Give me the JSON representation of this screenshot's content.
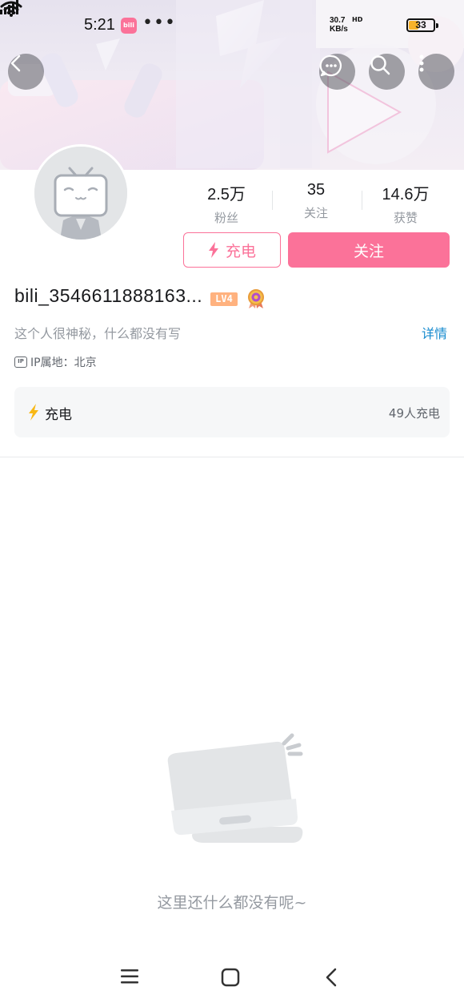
{
  "status_bar": {
    "time": "5:21",
    "app_badge": "bili",
    "dots": "•••",
    "net_speed_value": "30.7",
    "net_speed_unit": "KB/s",
    "hd_label": "HD",
    "battery_level": "33",
    "accent_color": "#f7b32b"
  },
  "header": {
    "back_icon": "chevron-left-icon",
    "message_icon": "chat-bubble-icon",
    "search_icon": "search-icon",
    "more_icon": "vertical-dots-icon"
  },
  "profile": {
    "avatar_icon": "bilibili-tv-mascot-avatar",
    "stats": [
      {
        "value": "2.5万",
        "label": "粉丝"
      },
      {
        "value": "35",
        "label": "关注"
      },
      {
        "value": "14.6万",
        "label": "获赞"
      }
    ],
    "charge_button_label": "充电",
    "follow_button_label": "关注",
    "username": "bili_3546611888163...",
    "level": "LV4",
    "signature": "这个人很神秘，什么都没有写",
    "detail_link": "详情",
    "ip_icon_text": "IP",
    "ip_location": "IP属地：北京",
    "brand_color": "#fb7299",
    "link_color": "#178bcf"
  },
  "charge_card": {
    "title": "充电",
    "count": "49人充电",
    "bolt_color": "#f8b816"
  },
  "empty_state": {
    "message": "这里还什么都没有呢~",
    "illustration_icon": "empty-box-illustration"
  },
  "nav_bar": {
    "menu_icon": "menu-icon",
    "home_icon": "home-square-icon",
    "back_icon": "nav-back-icon"
  }
}
